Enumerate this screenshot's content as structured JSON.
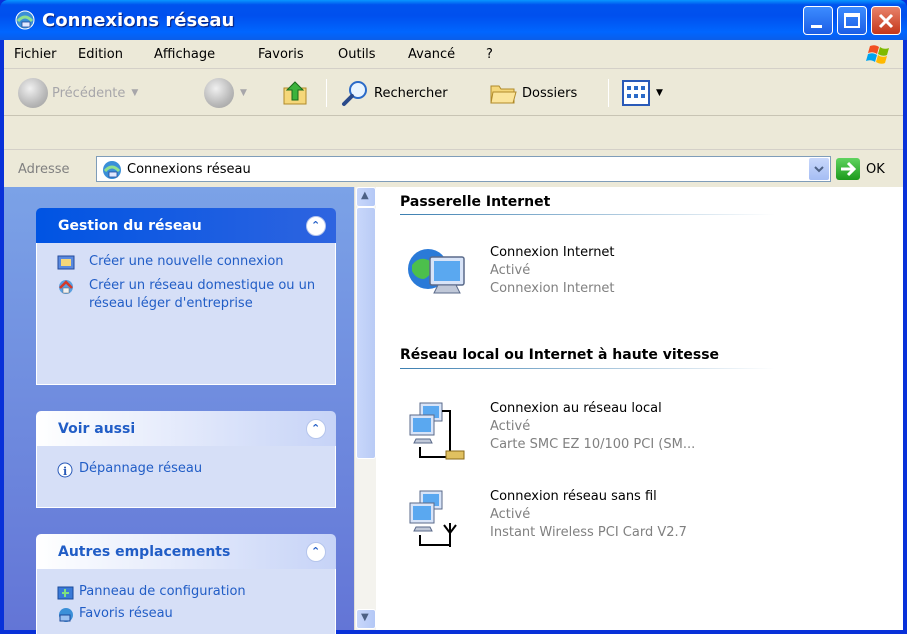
{
  "window": {
    "title": "Connexions réseau"
  },
  "menu": {
    "items": [
      "Fichier",
      "Edition",
      "Affichage",
      "Favoris",
      "Outils",
      "Avancé",
      "?"
    ]
  },
  "toolbar": {
    "back_label": "Précédente",
    "search_label": "Rechercher",
    "folders_label": "Dossiers"
  },
  "address": {
    "label": "Adresse",
    "value": "Connexions réseau",
    "go_label": "OK"
  },
  "taskpane": {
    "network_tasks": {
      "title": "Gestion du réseau",
      "items": [
        "Créer une nouvelle connexion",
        "Créer un réseau domestique ou un réseau léger d'entreprise"
      ]
    },
    "see_also": {
      "title": "Voir aussi",
      "items": [
        "Dépannage réseau"
      ]
    },
    "other_places": {
      "title": "Autres emplacements",
      "items": [
        "Panneau de configuration",
        "Favoris réseau"
      ]
    }
  },
  "groups": [
    {
      "title": "Passerelle Internet",
      "items": [
        {
          "name": "Connexion Internet",
          "status": "Activé",
          "device": "Connexion Internet",
          "icon": "internet-connection-icon"
        }
      ]
    },
    {
      "title": "Réseau local ou Internet à haute vitesse",
      "items": [
        {
          "name": "Connexion au réseau local",
          "status": "Activé",
          "device": "Carte SMC EZ 10/100 PCI (SM...",
          "icon": "lan-connection-icon"
        },
        {
          "name": "Connexion réseau sans fil",
          "status": "Activé",
          "device": "Instant Wireless PCI Card V2.7",
          "icon": "wireless-connection-icon"
        }
      ]
    }
  ],
  "colors": {
    "titlebar": "#0053ee",
    "taskpane": "#7ba2e7",
    "link": "#215dc6"
  }
}
